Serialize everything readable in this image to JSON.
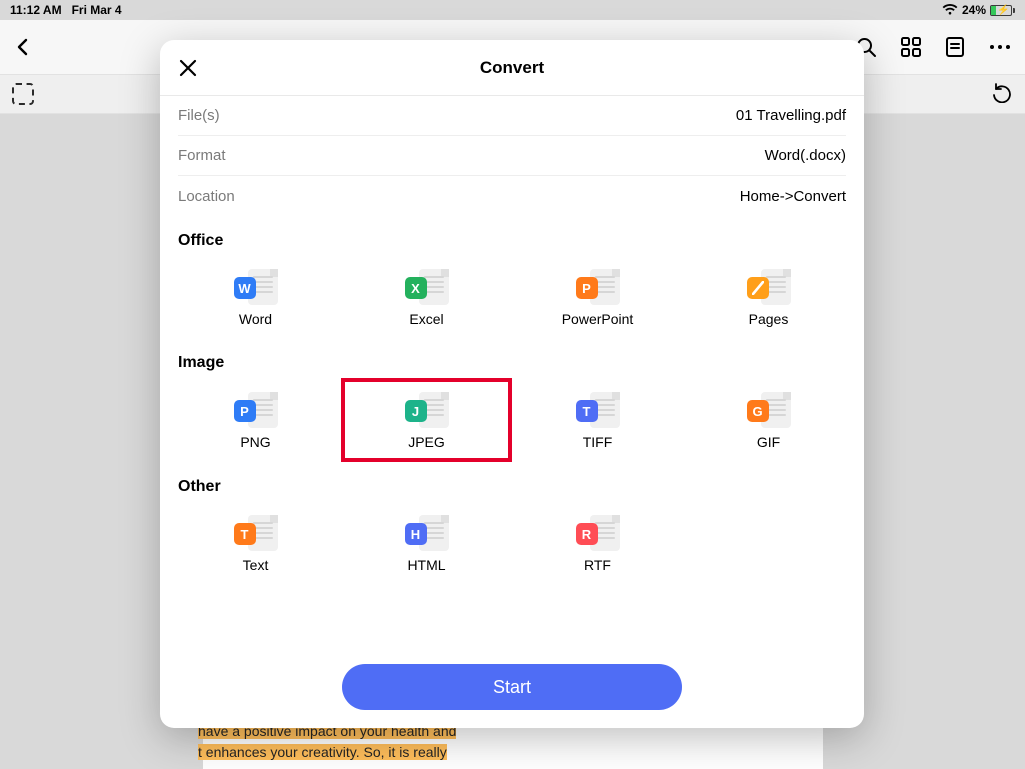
{
  "status": {
    "time": "11:12 AM",
    "date": "Fri Mar 4",
    "battery_pct": "24%"
  },
  "modal": {
    "title": "Convert",
    "rows": {
      "files_label": "File(s)",
      "files_value": "01 Travelling.pdf",
      "format_label": "Format",
      "format_value": "Word(.docx)",
      "location_label": "Location",
      "location_value": "Home->Convert"
    },
    "sections": {
      "office": "Office",
      "image": "Image",
      "other": "Other"
    },
    "formats": {
      "office": [
        {
          "label": "Word",
          "badge": "W",
          "cls": "word"
        },
        {
          "label": "Excel",
          "badge": "X",
          "cls": "excel"
        },
        {
          "label": "PowerPoint",
          "badge": "P",
          "cls": "ppt"
        },
        {
          "label": "Pages",
          "badge": "",
          "cls": "pages"
        }
      ],
      "image": [
        {
          "label": "PNG",
          "badge": "P",
          "cls": "png"
        },
        {
          "label": "JPEG",
          "badge": "J",
          "cls": "jpeg",
          "highlighted": true
        },
        {
          "label": "TIFF",
          "badge": "T",
          "cls": "tiff"
        },
        {
          "label": "GIF",
          "badge": "G",
          "cls": "gif"
        }
      ],
      "other": [
        {
          "label": "Text",
          "badge": "T",
          "cls": "text"
        },
        {
          "label": "HTML",
          "badge": "H",
          "cls": "html"
        },
        {
          "label": "RTF",
          "badge": "R",
          "cls": "rtf"
        }
      ]
    },
    "start_label": "Start"
  },
  "background_doc": {
    "lines": [
      "have a positive impact on your health and",
      "t enhances your creativity. So, it is really"
    ]
  }
}
